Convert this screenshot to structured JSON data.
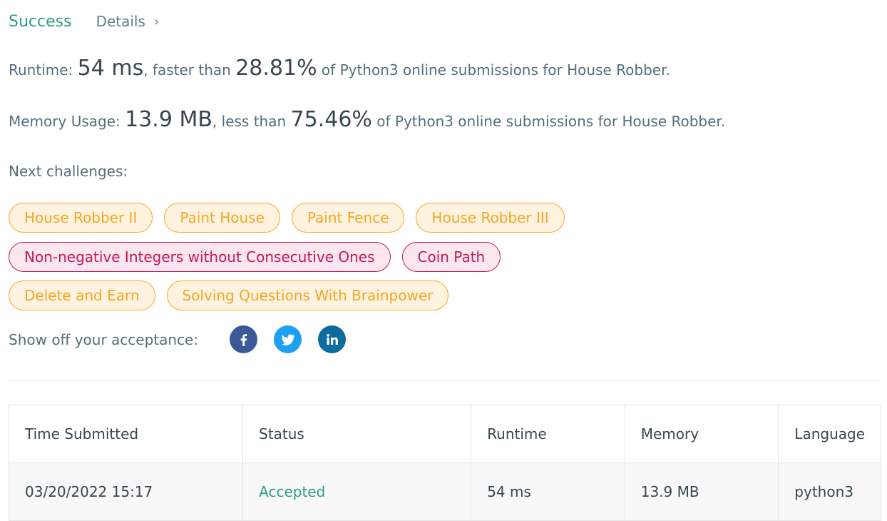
{
  "header": {
    "status": "Success",
    "details_label": "Details"
  },
  "runtime": {
    "label": "Runtime: ",
    "value": "54 ms",
    "comparison": ", faster than ",
    "percent": "28.81%",
    "suffix": " of Python3 online submissions for House Robber."
  },
  "memory": {
    "label": "Memory Usage: ",
    "value": "13.9 MB",
    "comparison": ", less than ",
    "percent": "75.46%",
    "suffix": " of Python3 online submissions for House Robber."
  },
  "next_challenges": {
    "label": "Next challenges:",
    "rows": [
      [
        {
          "label": "House Robber II",
          "difficulty": "medium"
        },
        {
          "label": "Paint House",
          "difficulty": "medium"
        },
        {
          "label": "Paint Fence",
          "difficulty": "medium"
        },
        {
          "label": "House Robber III",
          "difficulty": "medium"
        }
      ],
      [
        {
          "label": "Non-negative Integers without Consecutive Ones",
          "difficulty": "hard"
        },
        {
          "label": "Coin Path",
          "difficulty": "hard"
        }
      ],
      [
        {
          "label": "Delete and Earn",
          "difficulty": "medium"
        },
        {
          "label": "Solving Questions With Brainpower",
          "difficulty": "medium"
        }
      ]
    ]
  },
  "share": {
    "label": "Show off your acceptance:",
    "icons": [
      "facebook-icon",
      "twitter-icon",
      "linkedin-icon"
    ]
  },
  "table": {
    "headers": [
      "Time Submitted",
      "Status",
      "Runtime",
      "Memory",
      "Language"
    ],
    "rows": [
      [
        "03/20/2022 15:17",
        "Accepted",
        "54 ms",
        "13.9 MB",
        "python3"
      ]
    ]
  },
  "colors": {
    "accent": "#2e9c8a",
    "medium_tag": "#f5a623",
    "hard_tag": "#c2185b",
    "facebook": "#3b5998",
    "twitter": "#1da1f2",
    "linkedin": "#0e6b9e"
  }
}
